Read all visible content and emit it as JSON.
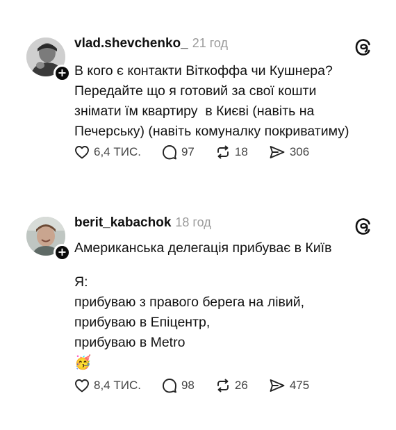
{
  "posts": [
    {
      "username": "vlad.shevchenko_",
      "time": "21 год",
      "lines": [
        "В кого є контакти Віткоффа чи Кушнера?",
        "Передайте що я готовий за свої кошти",
        "знімати їм квартиру  в Києві (навіть на",
        "Печерську) (навіть комуналку покриватиму)"
      ],
      "likes": "6,4 ТИС.",
      "comments": "97",
      "reposts": "18",
      "shares": "306"
    },
    {
      "username": "berit_kabachok",
      "time": "18 год",
      "lines": [
        "Американська делегація прибуває в Київ",
        "Я:",
        "прибуваю з правого берега на лівий,",
        "прибуваю в Епіцентр,",
        "прибуваю в Metro"
      ],
      "emoji": "🥳",
      "likes": "8,4 ТИС.",
      "comments": "98",
      "reposts": "26",
      "shares": "475"
    }
  ],
  "icons": {
    "avatar_badge": "plus-icon",
    "brand": "threads-logo-icon",
    "like": "heart-icon",
    "comment": "comment-icon",
    "repost": "repost-icon",
    "share": "share-icon"
  },
  "colors": {
    "text": "#101010",
    "muted": "#9a9a9a",
    "action": "#444444"
  }
}
